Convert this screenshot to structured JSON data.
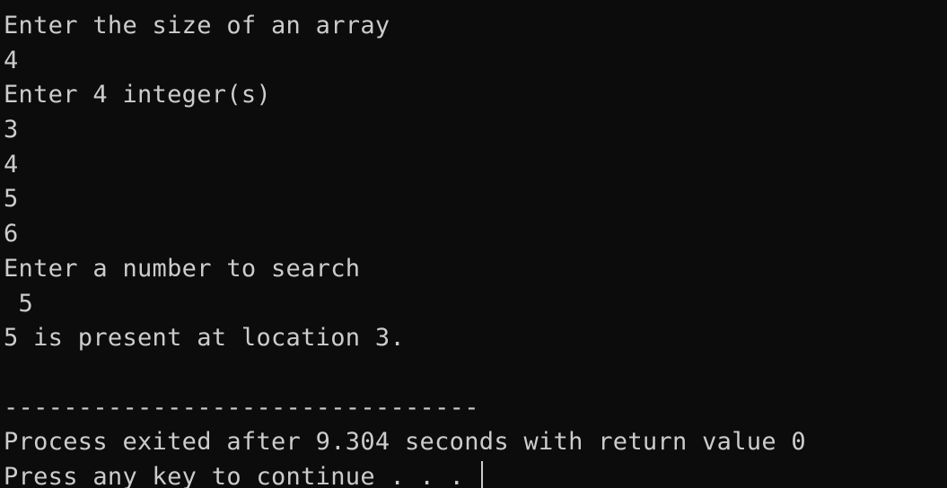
{
  "console": {
    "lines": [
      "Enter the size of an array",
      "4",
      "Enter 4 integer(s)",
      "3",
      "4",
      "5",
      "6",
      "Enter a number to search",
      " 5",
      "5 is present at location 3.",
      "",
      "--------------------------------",
      "Process exited after 9.304 seconds with return value 0",
      "Press any key to continue . . . "
    ]
  },
  "colors": {
    "background": "#0c0c0c",
    "foreground": "#cccccc"
  }
}
